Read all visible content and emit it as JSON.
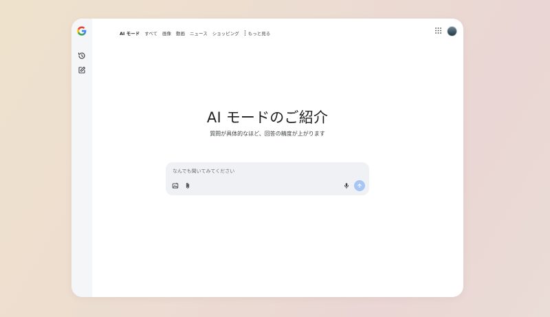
{
  "nav": {
    "tabs": [
      {
        "label": "AI モード",
        "active": true
      },
      {
        "label": "すべて"
      },
      {
        "label": "画像"
      },
      {
        "label": "動画"
      },
      {
        "label": "ニュース"
      },
      {
        "label": "ショッピング"
      }
    ],
    "more_label": "もっと見る"
  },
  "hero": {
    "title": "AI モードのご紹介",
    "subtitle": "質問が具体的なほど、回答の精度が上がります"
  },
  "search": {
    "placeholder": "なんでも聞いてみてください",
    "value": ""
  },
  "icons": {
    "logo": "google-g-logo",
    "sidebar": [
      "history-icon",
      "new-chat-icon"
    ],
    "header": [
      "apps-grid-icon"
    ],
    "search_left": [
      "image-upload-icon",
      "attach-icon"
    ],
    "search_right": [
      "microphone-icon",
      "send-arrow-icon"
    ]
  },
  "colors": {
    "send_button": "#a8c6f5",
    "search_box": "#eff1f4",
    "sidebar": "#f5f6f8"
  }
}
